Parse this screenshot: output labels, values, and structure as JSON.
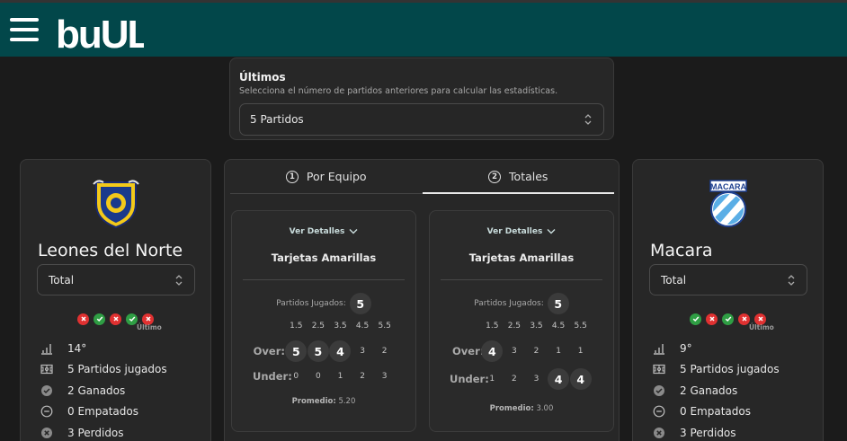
{
  "header": {
    "logo_text": "buUL",
    "menu_icon": "hamburger-icon"
  },
  "ultimos": {
    "title": "Últimos",
    "subtitle": "Selecciona el número de partidos anteriores para calcular las estadísticas.",
    "selected": "5 Partidos"
  },
  "tabs": [
    {
      "num": "1",
      "label": "Por Equipo",
      "active": false
    },
    {
      "num": "2",
      "label": "Totales",
      "active": true
    }
  ],
  "team_left": {
    "name": "Leones del Norte",
    "select": "Total",
    "form": [
      "l",
      "w",
      "l",
      "w",
      "l"
    ],
    "form_label": "Último",
    "stats": [
      {
        "icon": "ranking-bars-icon",
        "text": "14°"
      },
      {
        "icon": "field-icon",
        "text": "5 Partidos jugados"
      },
      {
        "icon": "check-circle-icon",
        "text": "2 Ganados"
      },
      {
        "icon": "minus-circle-icon",
        "text": "0 Empatados"
      },
      {
        "icon": "x-circle-icon",
        "text": "3 Perdidos"
      }
    ]
  },
  "team_right": {
    "name": "Macara",
    "select": "Total",
    "crest_text": "MACARA",
    "form": [
      "w",
      "l",
      "w",
      "l",
      "l"
    ],
    "form_label": "Último",
    "stats": [
      {
        "icon": "ranking-bars-icon",
        "text": "9°"
      },
      {
        "icon": "field-icon",
        "text": "5 Partidos jugados"
      },
      {
        "icon": "check-circle-icon",
        "text": "2 Ganados"
      },
      {
        "icon": "minus-circle-icon",
        "text": "0 Empatados"
      },
      {
        "icon": "x-circle-icon",
        "text": "3 Perdidos"
      }
    ]
  },
  "panels": [
    {
      "details": "Ver Detalles",
      "metric": "Tarjetas Amarillas",
      "played_label": "Partidos Jugados:",
      "played": "5",
      "lines": [
        "1.5",
        "2.5",
        "3.5",
        "4.5",
        "5.5"
      ],
      "over_label": "Over:",
      "over": [
        "5",
        "5",
        "4",
        "3",
        "2"
      ],
      "over_highlight": [
        true,
        true,
        true,
        false,
        false
      ],
      "under_label": "Under:",
      "under": [
        "0",
        "0",
        "1",
        "2",
        "3"
      ],
      "under_highlight": [
        false,
        false,
        false,
        false,
        false
      ],
      "avg_label": "Promedio:",
      "avg": "5.20"
    },
    {
      "details": "Ver Detalles",
      "metric": "Tarjetas Amarillas",
      "played_label": "Partidos Jugados:",
      "played": "5",
      "lines": [
        "1.5",
        "2.5",
        "3.5",
        "4.5",
        "5.5"
      ],
      "over_label": "Over:",
      "over": [
        "4",
        "3",
        "2",
        "1",
        "1"
      ],
      "over_highlight": [
        true,
        false,
        false,
        false,
        false
      ],
      "under_label": "Under:",
      "under": [
        "1",
        "2",
        "3",
        "4",
        "4"
      ],
      "under_highlight": [
        false,
        false,
        false,
        true,
        true
      ],
      "avg_label": "Promedio:",
      "avg": "3.00"
    }
  ],
  "colors": {
    "header": "#02474a",
    "win": "#2f9e44",
    "loss": "#e03131"
  }
}
